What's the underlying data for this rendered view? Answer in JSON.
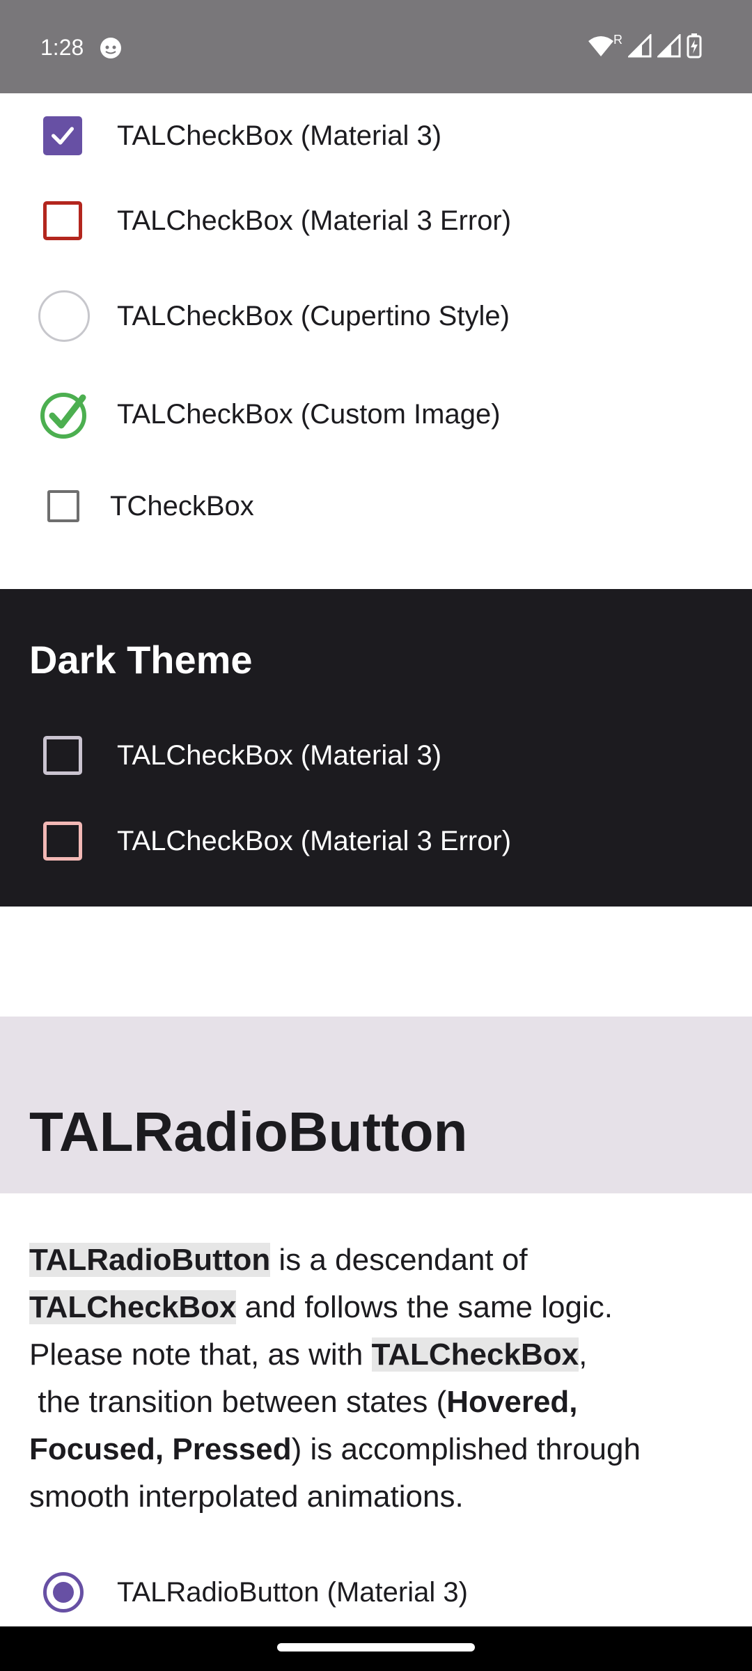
{
  "status": {
    "time": "1:28",
    "roaming_indicator": "R"
  },
  "checkboxes_light": [
    {
      "label": "TALCheckBox (Material 3)",
      "state": "checked"
    },
    {
      "label": "TALCheckBox (Material 3 Error)",
      "state": "unchecked"
    },
    {
      "label": "TALCheckBox (Cupertino  Style)",
      "state": "unchecked"
    },
    {
      "label": "TALCheckBox (Custom Image)",
      "state": "checked"
    },
    {
      "label": "TCheckBox",
      "state": "unchecked"
    }
  ],
  "dark_section": {
    "title": "Dark Theme",
    "items": [
      {
        "label": "TALCheckBox (Material 3)",
        "state": "unchecked"
      },
      {
        "label": "TALCheckBox (Material 3 Error)",
        "state": "unchecked"
      }
    ]
  },
  "radio_section": {
    "title": "TALRadioButton",
    "desc": {
      "p1_code": "TALRadioButton",
      "p1_text": " is a descendant of",
      "p2_code": "TALCheckBox",
      "p2_text": " and follows the same logic.",
      "p3_text": "Please note that, as with ",
      "p3_code": "TALCheckBox",
      "p3_end": ",",
      "p4_text": " the transition between states (",
      "p4_bold": "Hovered,",
      "p5_bold": "Focused, Pressed",
      "p5_text": ") is accomplished through",
      "p6_text": "smooth interpolated animations."
    },
    "items": [
      {
        "label": "TALRadioButton (Material 3)",
        "state": "selected"
      }
    ]
  },
  "colors": {
    "primary": "#6750a4",
    "error": "#b3261e",
    "custom_check": "#4caf50",
    "dark_bg": "#1c1b1f",
    "header_bg": "#e6e1e8"
  }
}
